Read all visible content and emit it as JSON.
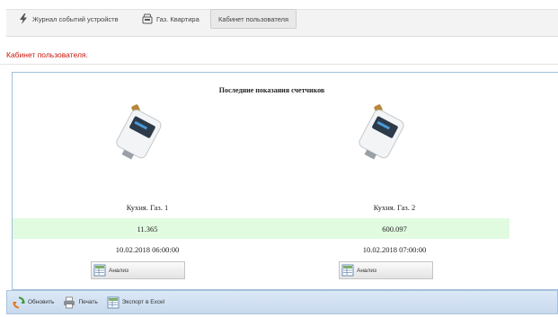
{
  "nav": {
    "tabs": [
      {
        "label": "Журнал событий устройств",
        "icon": "lightning-icon"
      },
      {
        "label": "Газ. Квартира",
        "icon": "gas-meter-icon"
      },
      {
        "label": "Кабинет пользователя",
        "icon": ""
      }
    ]
  },
  "page": {
    "title": "Кабинет пользователя."
  },
  "panel": {
    "title": "Последние показания счетчиков",
    "meters": [
      {
        "name": "Кухня. Газ. 1",
        "value": "11.365",
        "timestamp": "10.02.2018 06:00:00",
        "button_label": "Анализ"
      },
      {
        "name": "Кухня. Газ. 2",
        "value": "600.097",
        "timestamp": "10.02.2018 07:00:00",
        "button_label": "Анализ"
      }
    ]
  },
  "toolbar": {
    "refresh_label": "Обновить",
    "print_label": "Печать",
    "export_label": "Экспорт в Excel"
  },
  "colors": {
    "accent_red": "#c8160c",
    "value_band": "#e1fbe1",
    "panel_border": "#9fbfd9",
    "toolbar_blue": "#c9daee"
  }
}
